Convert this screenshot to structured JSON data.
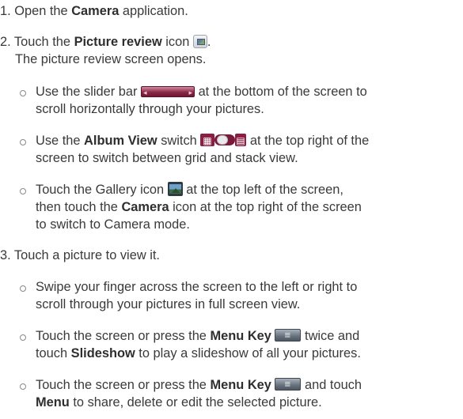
{
  "step1": {
    "pre": "1. Open the ",
    "bold": "Camera",
    "post": " application."
  },
  "step2": {
    "pre": "2. Touch the ",
    "bold": "Picture review",
    "mid": " icon ",
    "post": ".",
    "line2": "The picture review screen opens.",
    "icon": "picture-review-icon"
  },
  "bullet_a": {
    "pre": "Use the slider bar ",
    "post": " at the bottom of the screen to",
    "line2": "scroll horizontally through your pictures.",
    "icon": "slider-bar-icon"
  },
  "bullet_b": {
    "pre": "Use the ",
    "bold": "Album View",
    "mid": " switch ",
    "post": " at the top right of the",
    "line2": "screen to switch between grid and stack view.",
    "icon": "album-view-switch-icon"
  },
  "bullet_c": {
    "pre": "Touch the Gallery icon ",
    "post": " at the top left of the screen,",
    "line2_pre": "then touch the ",
    "line2_bold": "Camera",
    "line2_post": " icon at the top right of the screen",
    "line3": "to switch to Camera mode.",
    "icon": "gallery-icon"
  },
  "step3": {
    "text": "3. Touch a picture to view it."
  },
  "bullet_d": {
    "line1": "Swipe your finger across the screen to the left or right to",
    "line2": "scroll through your pictures in full screen view."
  },
  "bullet_e": {
    "pre": "Touch the screen or press the ",
    "bold": "Menu Key",
    "post": " twice and",
    "line2_pre": "touch ",
    "line2_bold": "Slideshow",
    "line2_post": " to play a slideshow of all your pictures.",
    "icon": "menu-key-icon"
  },
  "bullet_f": {
    "pre": "Touch the screen or press the ",
    "bold": "Menu Key",
    "post": " and touch",
    "line2_bold": "Menu",
    "line2_post": " to share, delete or edit the selected picture.",
    "icon": "menu-key-icon"
  },
  "colors": {
    "text": "#3a3a3a",
    "accent": "#8b1f43"
  }
}
